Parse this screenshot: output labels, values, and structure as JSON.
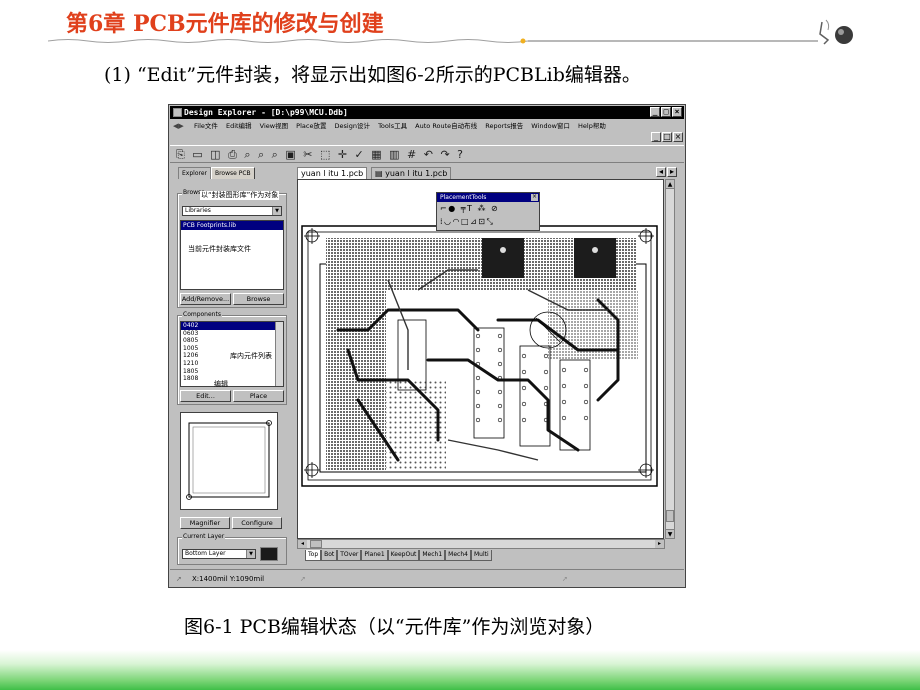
{
  "slide": {
    "chapter_title": "第6章   PCB元件库的修改与创建",
    "intro": "(1) “Edit”元件封装，将显示出如图6-2所示的PCBLib编辑器。",
    "caption": "图6-1  PCB编辑状态（以“元件库”作为浏览对象）"
  },
  "window": {
    "title": "Design Explorer - [D:\\p99\\MCU.Ddb]",
    "menu": [
      "File文件",
      "Edit编辑",
      "View视图",
      "Place放置",
      "Design设计",
      "Tools工具",
      "Auto Route自动布线",
      "Reports报告",
      "Window窗口",
      "Help帮助"
    ],
    "toolbar_glyphs": "⎘ ▭ ◫ ⎙  ⌕ ⌕ ⌕ ▣  ✂ ⬚ ✛  ✓  ▦ ▥  #  ↶ ↷ ?"
  },
  "left_panel": {
    "tabs": [
      "Explorer",
      "Browse PCB"
    ],
    "browse_label": "Browse",
    "browse_annotation": "以“封装图形库”作为对象",
    "browse_value": "Libraries",
    "selected_library": "PCB Footprints.lib",
    "library_annotation": "当前元件封装库文件",
    "add_remove_label": "Add/Remove...",
    "browse_button_label": "Browse",
    "components_label": "Components",
    "components": [
      "0402",
      "0603",
      "0805",
      "1005",
      "1206",
      "1210",
      "1805",
      "1808"
    ],
    "components_annotation": "库内元件列表",
    "edit_annotation": "编辑",
    "edit_button_label": "Edit...",
    "place_button_label": "Place",
    "magnifier_label": "Magnifier",
    "configure_label": "Configure",
    "current_layer_label": "Current Layer",
    "current_layer_value": "Bottom Layer",
    "layer_color": "#1a1a1a"
  },
  "documents": {
    "tabs": [
      "yuan l itu 1.pcb",
      "yuan l itu 1.pcb"
    ]
  },
  "placement_tools": {
    "title": "PlacementTools",
    "row1": "⌐● ╤T ⁂ ⊘",
    "row2": "⁞◡◠□⊿⊡⤡"
  },
  "layers": [
    "Top",
    "Bot",
    "TOver",
    "Plane1",
    "KeepOut",
    "Mech1",
    "Mech4",
    "Multi"
  ],
  "status": {
    "coordinates": "X:1400mil Y:1090mil"
  },
  "colors": {
    "title_red": "#e0401c",
    "band_green": "#3fbf48",
    "selection_blue": "#000080"
  }
}
